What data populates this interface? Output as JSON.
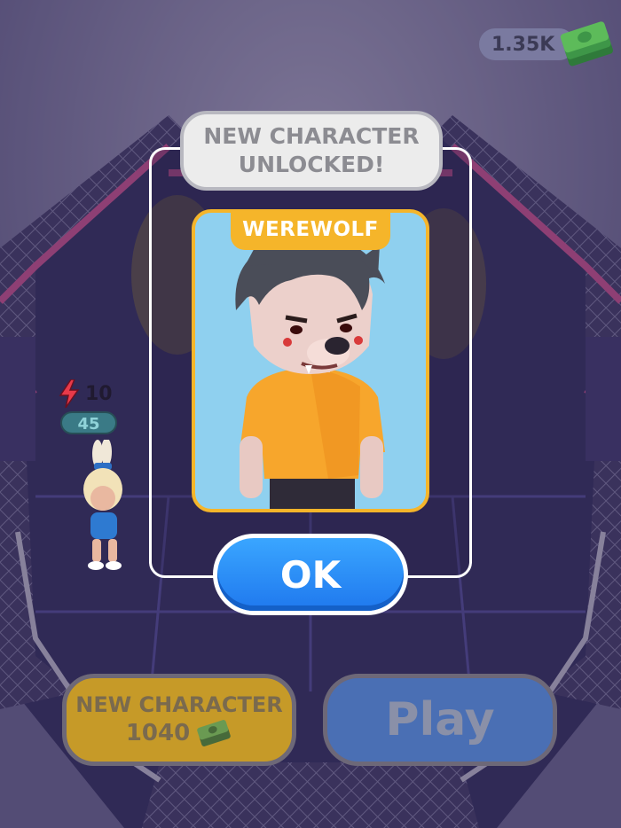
{
  "hud": {
    "money": "1.35K"
  },
  "fighter": {
    "power": "10",
    "health": "45"
  },
  "dialog": {
    "title_line1": "NEW CHARACTER",
    "title_line2": "UNLOCKED!",
    "character_name": "WEREWOLF",
    "ok_label": "OK"
  },
  "bottom": {
    "new_character_label": "NEW CHARACTER",
    "new_character_cost": "1040",
    "play_label": "Play"
  },
  "colors": {
    "card_border": "#f5b52a",
    "card_bg": "#8fd0ef",
    "ok_button": "#2a8cf5",
    "new_character_button": "#c69a28",
    "play_button": "#4a6fb4"
  },
  "icons": [
    "cash-stack-icon",
    "lightning-bolt-icon"
  ]
}
